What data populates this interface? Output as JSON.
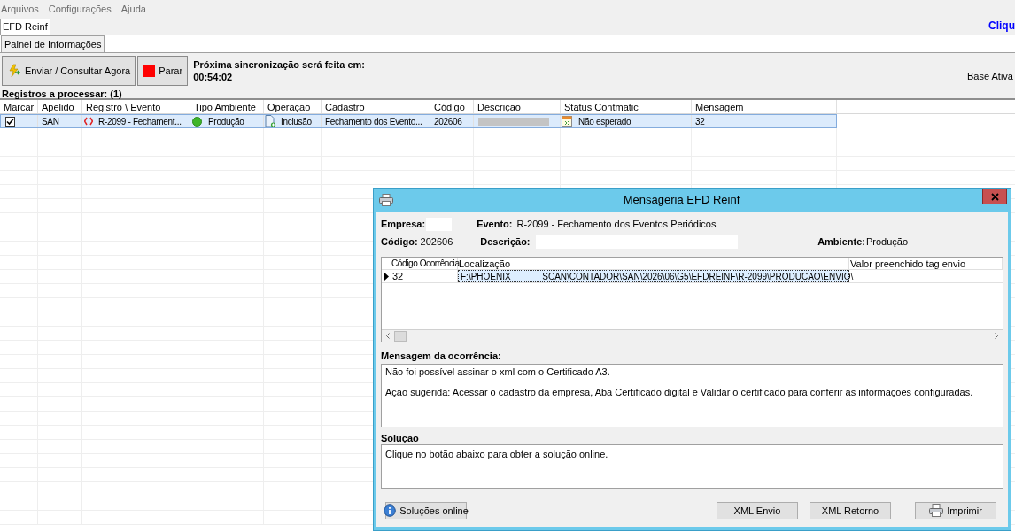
{
  "menu": [
    "Arquivos",
    "Configurações",
    "Ajuda"
  ],
  "tabs": [
    {
      "label": "EFD Reinf",
      "selected": true
    }
  ],
  "right_link": "Cliqu",
  "subtabs": [
    {
      "label": "Painel de Informações",
      "selected": true
    }
  ],
  "toolbar": [
    {
      "label": "Enviar / Consultar Agora",
      "kind": "send"
    },
    {
      "label": "Parar",
      "kind": "stop"
    }
  ],
  "sync": {
    "label": "Próxima sincronização será feita em:",
    "time": "00:54:02"
  },
  "base_status": "Base Ativa",
  "queue_label": "Registros a processar: (1)",
  "table": {
    "columns": [
      "Marcar",
      "Apelido",
      "Registro \\ Evento",
      "Tipo Ambiente",
      "Operação",
      "Cadastro",
      "Código",
      "Descrição",
      "Status Contmatic",
      "Mensagem"
    ],
    "rows": [
      {
        "checked": true,
        "selected": true,
        "apelido": "SAN",
        "registro": "R-2099 - Fechament...",
        "ambiente": "Produção",
        "operacao": "Inclusão",
        "cadastro": "Fechamento dos Evento...",
        "codigo": "202606",
        "descricao_redacted": true,
        "status": "Não esperado",
        "mensagem": "32"
      }
    ]
  },
  "dialog": {
    "title": "Mensageria EFD Reinf",
    "empresa_label": "Empresa:",
    "evento_label": "Evento:",
    "evento": "R-2099 - Fechamento dos Eventos Periódicos",
    "codigo_label": "Código:",
    "codigo": "202606",
    "descricao_label": "Descrição:",
    "ambiente_label": "Ambiente:",
    "ambiente": "Produção",
    "grid": {
      "columns": [
        "Código Ocorrência",
        "Localização",
        "Valor preenchido tag envio"
      ],
      "rows": [
        {
          "selected": true,
          "codigo": "32",
          "localizacao": "F:\\PHOENIX_",
          "localizacao_rest": "SCAN\\CONTADOR\\SAN\\2026\\06\\G5\\EFDREINF\\R-2099\\PRODUCAO\\ENVIO\\"
        }
      ]
    },
    "message_label": "Mensagem da ocorrência:",
    "message": [
      "Não foi possível assinar o xml com o Certificado A3.",
      "Ação sugerida: Acessar o cadastro da empresa, Aba Certificado digital e Validar o certificado para conferir as informações configuradas."
    ],
    "solution_label": "Solução",
    "solution": "Clique no botão abaixo para obter a solução online.",
    "buttons": [
      {
        "label": "Soluções online",
        "kind": "info"
      },
      {
        "label": "XML Envio",
        "kind": "plain"
      },
      {
        "label": "XML Retorno",
        "kind": "plain"
      },
      {
        "label": "Imprimir",
        "kind": "print"
      }
    ]
  }
}
